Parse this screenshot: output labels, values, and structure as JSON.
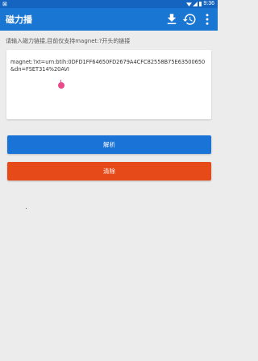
{
  "status_bar": {
    "left_text": "⊠",
    "time": "9:36"
  },
  "app_bar": {
    "title": "磁力播",
    "actions": [
      "download-icon",
      "history-icon",
      "more-vert-icon"
    ]
  },
  "hint_text": "请输入磁力链接,目前仅支持magnet:?开头的链接",
  "magnet_input": {
    "value": "magnet:?xt=urn:btih:0DFD1FF64650FD2679A4CFC82558B75E63500650&dn=FSET314%20AVI"
  },
  "buttons": {
    "parse_label": "解析",
    "clear_label": "清除"
  },
  "colors": {
    "primary": "#1976d2",
    "primary_dark": "#1565c0",
    "parse_button": "#1a73d6",
    "clear_button": "#e64a19",
    "cursor": "#e84a8a",
    "background": "#ececec"
  }
}
